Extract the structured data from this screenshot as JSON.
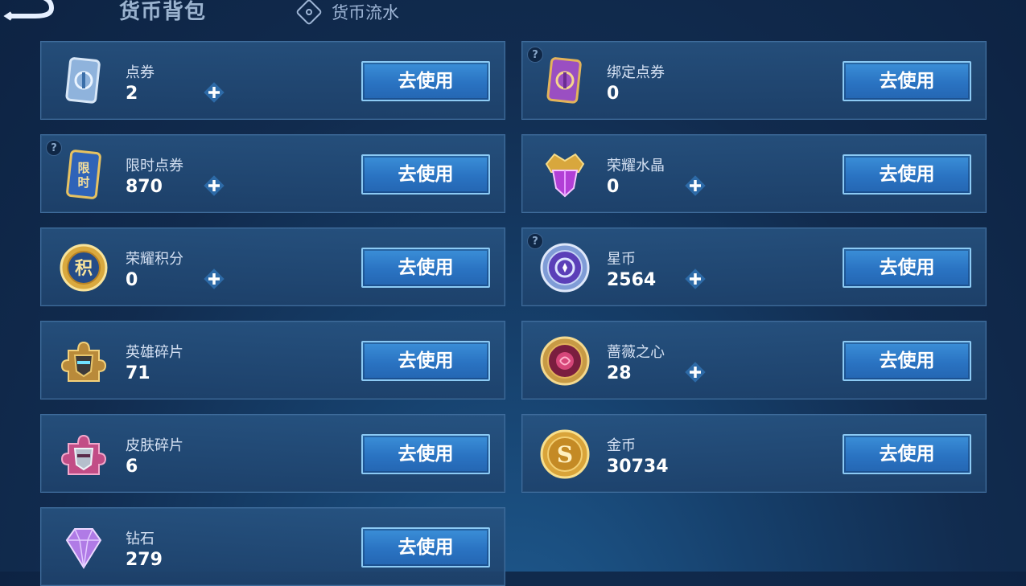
{
  "header": {
    "title": "货币背包",
    "flow_tab_label": "货币流水"
  },
  "use_label": "去使用",
  "currencies": [
    {
      "name": "点券",
      "value": "2",
      "icon": "coupon-card-icon"
    },
    {
      "name": "绑定点券",
      "value": "0",
      "icon": "bound-coupon-card-icon"
    },
    {
      "name": "限时点券",
      "value": "870",
      "icon": "limited-coupon-icon",
      "icon_text": "限时"
    },
    {
      "name": "荣耀水晶",
      "value": "0",
      "icon": "glory-crystal-icon"
    },
    {
      "name": "荣耀积分",
      "value": "0",
      "icon": "glory-points-icon",
      "icon_text": "积"
    },
    {
      "name": "星币",
      "value": "2564",
      "icon": "star-coin-icon"
    },
    {
      "name": "英雄碎片",
      "value": "71",
      "icon": "hero-fragment-icon"
    },
    {
      "name": "蔷薇之心",
      "value": "28",
      "icon": "rose-heart-icon"
    },
    {
      "name": "皮肤碎片",
      "value": "6",
      "icon": "skin-fragment-icon"
    },
    {
      "name": "金币",
      "value": "30734",
      "icon": "gold-coin-icon"
    },
    {
      "name": "钻石",
      "value": "279",
      "icon": "diamond-icon"
    }
  ],
  "colors": {
    "background": "#112b4e",
    "card": "#244c7a",
    "button": "#2a73c2",
    "button_border": "#8ccaf4"
  }
}
